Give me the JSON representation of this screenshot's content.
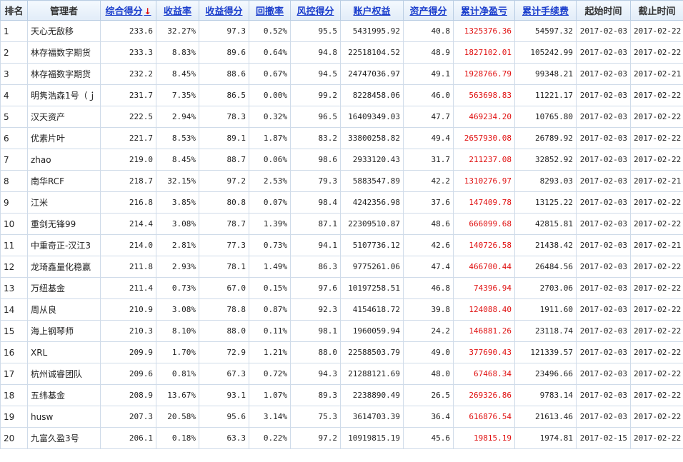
{
  "headers": [
    "排名",
    "管理者",
    "综合得分",
    "收益率",
    "收益得分",
    "回撤率",
    "风控得分",
    "账户权益",
    "资产得分",
    "累计净盈亏",
    "累计手续费",
    "起始时间",
    "截止时间"
  ],
  "sort_arrow": "↓",
  "rows": [
    [
      "1",
      "天心无敌移",
      "233.6",
      "32.27%",
      "97.3",
      "0.52%",
      "95.5",
      "5431995.92",
      "40.8",
      "1325376.36",
      "54597.32",
      "2017-02-03",
      "2017-02-22"
    ],
    [
      "2",
      "林存福数字期货",
      "233.3",
      "8.83%",
      "89.6",
      "0.64%",
      "94.8",
      "22518104.52",
      "48.9",
      "1827102.01",
      "105242.99",
      "2017-02-03",
      "2017-02-22"
    ],
    [
      "3",
      "林存福数字期货",
      "232.2",
      "8.45%",
      "88.6",
      "0.67%",
      "94.5",
      "24747036.97",
      "49.1",
      "1928766.79",
      "99348.21",
      "2017-02-03",
      "2017-02-21"
    ],
    [
      "4",
      "明隽浩森1号（ｊ",
      "231.7",
      "7.35%",
      "86.5",
      "0.00%",
      "99.2",
      "8228458.06",
      "46.0",
      "563698.83",
      "11221.17",
      "2017-02-03",
      "2017-02-22"
    ],
    [
      "5",
      "汉天资产",
      "222.5",
      "2.94%",
      "78.3",
      "0.32%",
      "96.5",
      "16409349.03",
      "47.7",
      "469234.20",
      "10765.80",
      "2017-02-03",
      "2017-02-22"
    ],
    [
      "6",
      "优素片叶",
      "221.7",
      "8.53%",
      "89.1",
      "1.87%",
      "83.2",
      "33800258.82",
      "49.4",
      "2657930.08",
      "26789.92",
      "2017-02-03",
      "2017-02-22"
    ],
    [
      "7",
      "zhao",
      "219.0",
      "8.45%",
      "88.7",
      "0.06%",
      "98.6",
      "2933120.43",
      "31.7",
      "211237.08",
      "32852.92",
      "2017-02-03",
      "2017-02-22"
    ],
    [
      "8",
      "南华RCF",
      "218.7",
      "32.15%",
      "97.2",
      "2.53%",
      "79.3",
      "5883547.89",
      "42.2",
      "1310276.97",
      "8293.03",
      "2017-02-03",
      "2017-02-21"
    ],
    [
      "9",
      "江米",
      "216.8",
      "3.85%",
      "80.8",
      "0.07%",
      "98.4",
      "4242356.98",
      "37.6",
      "147409.78",
      "13125.22",
      "2017-02-03",
      "2017-02-22"
    ],
    [
      "10",
      "重剑无锋99",
      "214.4",
      "3.08%",
      "78.7",
      "1.39%",
      "87.1",
      "22309510.87",
      "48.6",
      "666099.68",
      "42815.81",
      "2017-02-03",
      "2017-02-22"
    ],
    [
      "11",
      "中重奇正-汉江3",
      "214.0",
      "2.81%",
      "77.3",
      "0.73%",
      "94.1",
      "5107736.12",
      "42.6",
      "140726.58",
      "21438.42",
      "2017-02-03",
      "2017-02-21"
    ],
    [
      "12",
      "龙琦鑫量化稳赢",
      "211.8",
      "2.93%",
      "78.1",
      "1.49%",
      "86.3",
      "9775261.06",
      "47.4",
      "466700.44",
      "26484.56",
      "2017-02-03",
      "2017-02-22"
    ],
    [
      "13",
      "万纽基金",
      "211.4",
      "0.73%",
      "67.0",
      "0.15%",
      "97.6",
      "10197258.51",
      "46.8",
      "74396.94",
      "2703.06",
      "2017-02-03",
      "2017-02-22"
    ],
    [
      "14",
      "周从良",
      "210.9",
      "3.08%",
      "78.8",
      "0.87%",
      "92.3",
      "4154618.72",
      "39.8",
      "124088.40",
      "1911.60",
      "2017-02-03",
      "2017-02-22"
    ],
    [
      "15",
      "海上钢琴师",
      "210.3",
      "8.10%",
      "88.0",
      "0.11%",
      "98.1",
      "1960059.94",
      "24.2",
      "146881.26",
      "23118.74",
      "2017-02-03",
      "2017-02-22"
    ],
    [
      "16",
      "XRL",
      "209.9",
      "1.70%",
      "72.9",
      "1.21%",
      "88.0",
      "22588503.79",
      "49.0",
      "377690.43",
      "121339.57",
      "2017-02-03",
      "2017-02-22"
    ],
    [
      "17",
      "杭州诚睿团队",
      "209.6",
      "0.81%",
      "67.3",
      "0.72%",
      "94.3",
      "21288121.69",
      "48.0",
      "67468.34",
      "23496.66",
      "2017-02-03",
      "2017-02-22"
    ],
    [
      "18",
      "五纬基金",
      "208.9",
      "13.67%",
      "93.1",
      "1.07%",
      "89.3",
      "2238890.49",
      "26.5",
      "269326.86",
      "9783.14",
      "2017-02-03",
      "2017-02-22"
    ],
    [
      "19",
      "husw",
      "207.3",
      "20.58%",
      "95.6",
      "3.14%",
      "75.3",
      "3614703.39",
      "36.4",
      "616876.54",
      "21613.46",
      "2017-02-03",
      "2017-02-22"
    ],
    [
      "20",
      "九富久盈3号",
      "206.1",
      "0.18%",
      "63.3",
      "0.22%",
      "97.2",
      "10919815.19",
      "45.6",
      "19815.19",
      "1974.81",
      "2017-02-15",
      "2017-02-22"
    ]
  ]
}
